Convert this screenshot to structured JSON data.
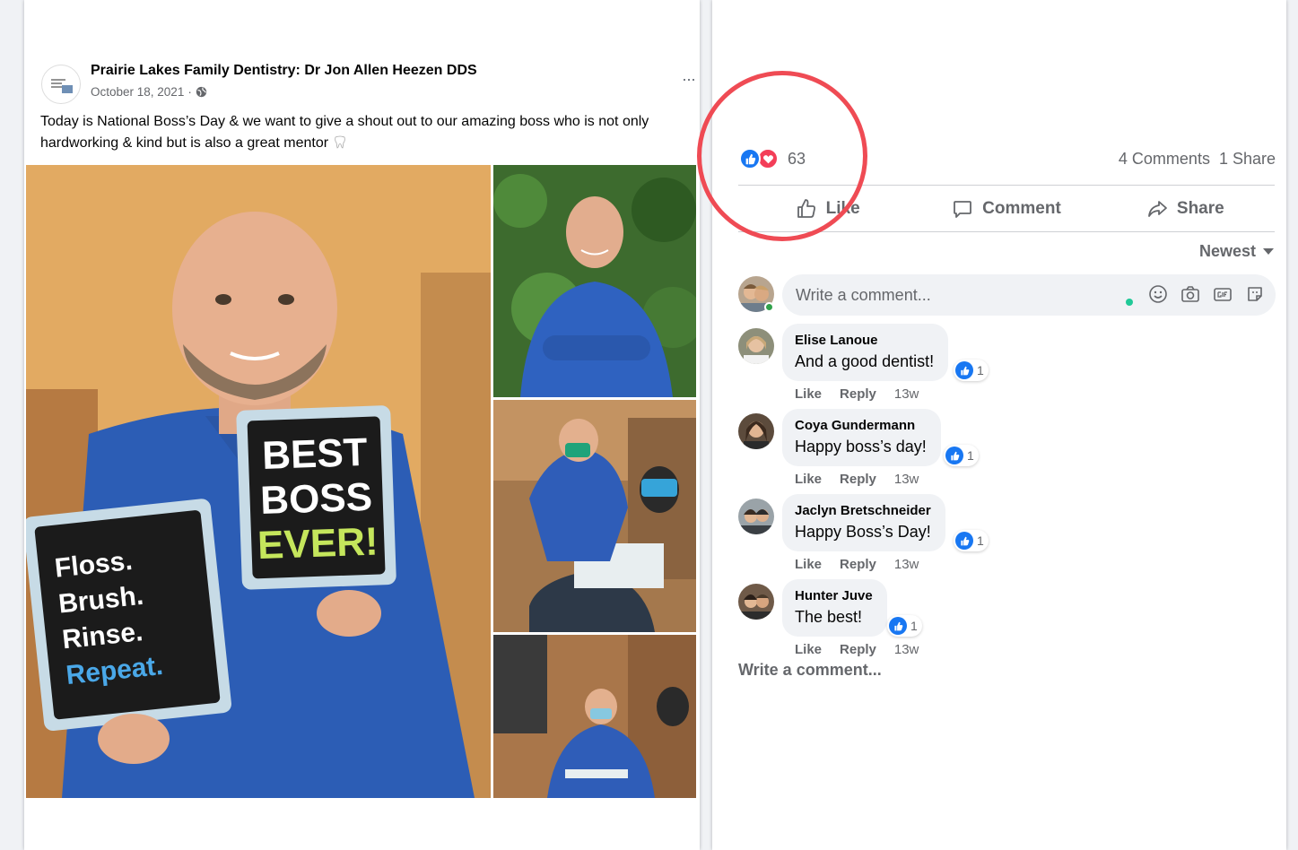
{
  "post": {
    "page_name": "Prairie Lakes Family Dentistry: Dr Jon Allen Heezen DDS",
    "date": "October 18, 2021",
    "separator": "·",
    "text": "Today is National Boss’s Day & we want to give a shout out to our amazing boss who is not only hardworking & kind but is also a great mentor",
    "more_icon": "···",
    "sign_left": [
      "Floss.",
      "Brush.",
      "Rinse.",
      "Repeat."
    ],
    "sign_right": [
      "BEST",
      "BOSS",
      "EVER!"
    ]
  },
  "reactions": {
    "count": "63",
    "comments": "4 Comments",
    "shares": "1 Share",
    "icons": [
      "like-icon",
      "love-icon"
    ]
  },
  "actions": {
    "like": "Like",
    "comment": "Comment",
    "share": "Share"
  },
  "sort": {
    "label": "Newest"
  },
  "composer": {
    "placeholder": "Write a comment..."
  },
  "comments": [
    {
      "author": "Elise Lanoue",
      "text": "And a good dentist!",
      "likes": "1",
      "like": "Like",
      "reply": "Reply",
      "time": "13w"
    },
    {
      "author": "Coya Gundermann",
      "text": "Happy boss’s day!",
      "likes": "1",
      "like": "Like",
      "reply": "Reply",
      "time": "13w"
    },
    {
      "author": "Jaclyn Bretschneider",
      "text": "Happy Boss’s Day!",
      "likes": "1",
      "like": "Like",
      "reply": "Reply",
      "time": "13w"
    },
    {
      "author": "Hunter Juve",
      "text": "The best!",
      "likes": "1",
      "like": "Like",
      "reply": "Reply",
      "time": "13w"
    }
  ],
  "write_comment": "Write a comment...",
  "colors": {
    "accent": "#1877f2",
    "love": "#f33e58",
    "highlight": "#ef4b54",
    "muted": "#65676b"
  }
}
